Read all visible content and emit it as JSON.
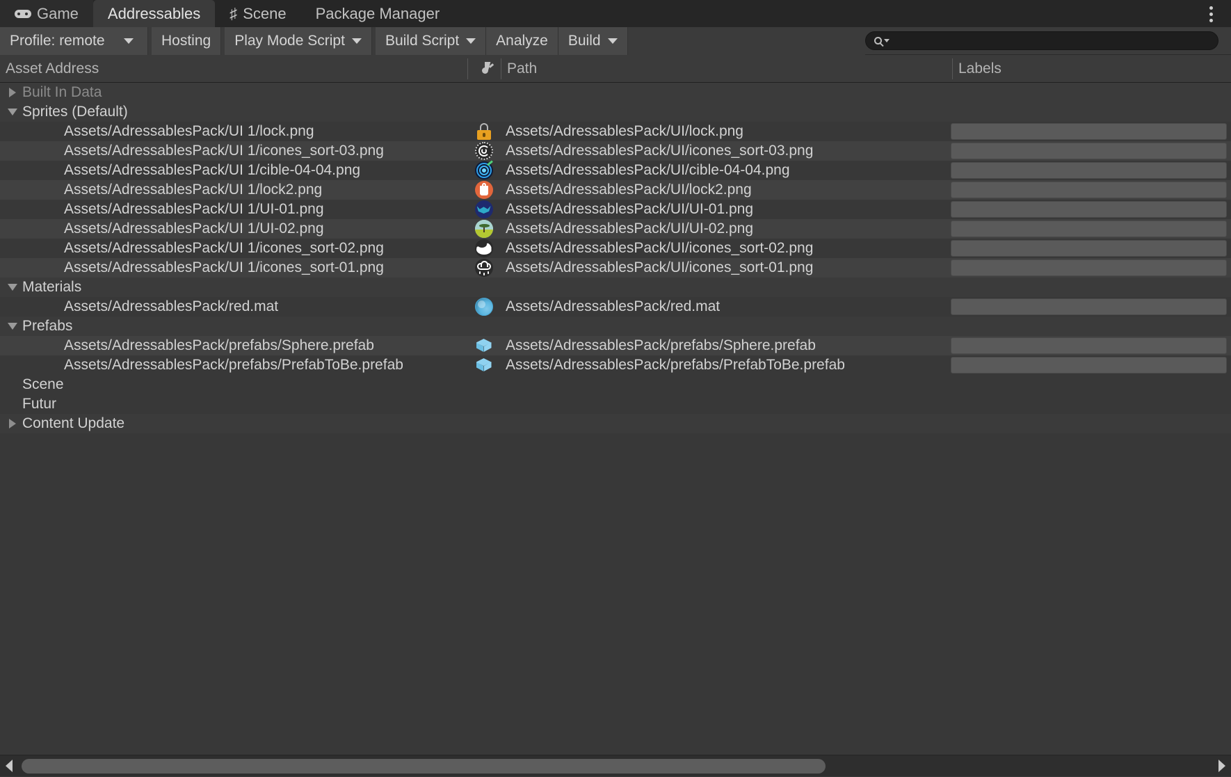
{
  "window": {
    "tabs": [
      {
        "label": "Game",
        "icon": "gamepad-icon",
        "active": false
      },
      {
        "label": "Addressables",
        "icon": "",
        "active": true
      },
      {
        "label": "Scene",
        "icon": "hash-icon",
        "active": false
      },
      {
        "label": "Package Manager",
        "icon": "",
        "active": false
      }
    ],
    "menu_icon": "kebab-menu-icon"
  },
  "toolbar": {
    "profile_label": "Profile: remote",
    "hosting_label": "Hosting",
    "play_mode_script_label": "Play Mode Script",
    "build_script_label": "Build Script",
    "analyze_label": "Analyze",
    "build_label": "Build",
    "search_placeholder": "",
    "search_value": "",
    "search_icon": "search-icon",
    "dropdown_icon": "chevron-down-icon"
  },
  "columns": {
    "asset_address": "Asset Address",
    "icon_column": "",
    "path": "Path",
    "labels": "Labels"
  },
  "tree": [
    {
      "type": "group",
      "label": "Built In Data",
      "expanded": false,
      "arrow": true,
      "dim": true
    },
    {
      "type": "group",
      "label": "Sprites (Default)",
      "expanded": true,
      "arrow": true,
      "dim": false
    },
    {
      "type": "asset",
      "label": "Assets/AdressablesPack/UI 1/lock.png",
      "path": "Assets/AdressablesPack/UI/lock.png",
      "icon": "sprite-lock-icon",
      "labels": ""
    },
    {
      "type": "asset",
      "label": "Assets/AdressablesPack/UI 1/icones_sort-03.png",
      "path": "Assets/AdressablesPack/UI/icones_sort-03.png",
      "icon": "sprite-spiral-icon",
      "labels": ""
    },
    {
      "type": "asset",
      "label": "Assets/AdressablesPack/UI 1/cible-04-04.png",
      "path": "Assets/AdressablesPack/UI/cible-04-04.png",
      "icon": "sprite-target-icon",
      "labels": ""
    },
    {
      "type": "asset",
      "label": "Assets/AdressablesPack/UI 1/lock2.png",
      "path": "Assets/AdressablesPack/UI/lock2.png",
      "icon": "sprite-lock2-icon",
      "labels": ""
    },
    {
      "type": "asset",
      "label": "Assets/AdressablesPack/UI 1/UI-01.png",
      "path": "Assets/AdressablesPack/UI/UI-01.png",
      "icon": "sprite-bat-icon",
      "labels": ""
    },
    {
      "type": "asset",
      "label": "Assets/AdressablesPack/UI 1/UI-02.png",
      "path": "Assets/AdressablesPack/UI/UI-02.png",
      "icon": "sprite-landscape-icon",
      "labels": ""
    },
    {
      "type": "asset",
      "label": "Assets/AdressablesPack/UI 1/icones_sort-02.png",
      "path": "Assets/AdressablesPack/UI/icones_sort-02.png",
      "icon": "sprite-crescent-icon",
      "labels": ""
    },
    {
      "type": "asset",
      "label": "Assets/AdressablesPack/UI 1/icones_sort-01.png",
      "path": "Assets/AdressablesPack/UI/icones_sort-01.png",
      "icon": "sprite-cloud-icon",
      "labels": ""
    },
    {
      "type": "group",
      "label": "Materials",
      "expanded": true,
      "arrow": true,
      "dim": false
    },
    {
      "type": "asset",
      "label": "Assets/AdressablesPack/red.mat",
      "path": "Assets/AdressablesPack/red.mat",
      "icon": "material-sphere-icon",
      "labels": ""
    },
    {
      "type": "group",
      "label": "Prefabs",
      "expanded": true,
      "arrow": true,
      "dim": false
    },
    {
      "type": "asset",
      "label": "Assets/AdressablesPack/prefabs/Sphere.prefab",
      "path": "Assets/AdressablesPack/prefabs/Sphere.prefab",
      "icon": "prefab-cube-icon",
      "labels": ""
    },
    {
      "type": "asset",
      "label": "Assets/AdressablesPack/prefabs/PrefabToBe.prefab",
      "path": "Assets/AdressablesPack/prefabs/PrefabToBe.prefab",
      "icon": "prefab-cube-icon",
      "labels": ""
    },
    {
      "type": "leaf",
      "label": "Scene",
      "expanded": false,
      "arrow": false,
      "dim": false
    },
    {
      "type": "leaf",
      "label": "Futur",
      "expanded": false,
      "arrow": false,
      "dim": false
    },
    {
      "type": "group",
      "label": "Content Update",
      "expanded": false,
      "arrow": true,
      "dim": false
    }
  ],
  "scrollbar": {
    "left_arrow_icon": "chevron-left-icon",
    "right_arrow_icon": "chevron-right-icon",
    "thumb_fraction": 0.673
  },
  "colors": {
    "window_bg": "#383838",
    "tabbar_bg": "#262626",
    "toolbar_btn": "#484848",
    "row_alt": "#414141",
    "text": "#d2d2d2",
    "text_dim": "#8b8b8b"
  }
}
